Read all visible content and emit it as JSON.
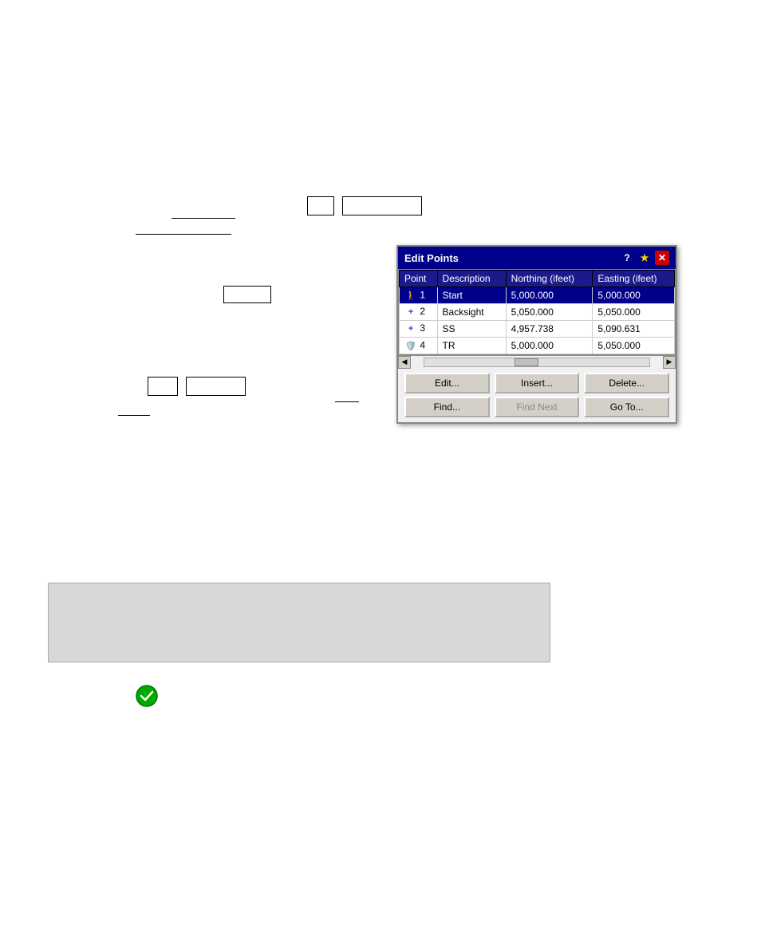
{
  "page": {
    "background": "#ffffff"
  },
  "topElements": {
    "box1": {
      "label": ""
    },
    "box2": {
      "label": ""
    },
    "underline1": {
      "text": ""
    },
    "underline2": {
      "text": ""
    },
    "smallBox": {
      "label": ""
    },
    "bottomBox1": {
      "label": ""
    },
    "bottomBox2": {
      "label": ""
    },
    "underline3": {
      "text": ""
    }
  },
  "dialog": {
    "title": "Edit Points",
    "helpIcon": "?",
    "pinIcon": "★",
    "closeIcon": "✕",
    "columns": [
      "Point",
      "Description",
      "Northing (ifeet)",
      "Easting (ifeet)"
    ],
    "rows": [
      {
        "id": 1,
        "icon": "person",
        "description": "Start",
        "northing": "5,000.000",
        "easting": "5,000.000",
        "selected": true
      },
      {
        "id": 2,
        "icon": "plus",
        "description": "Backsight",
        "northing": "5,050.000",
        "easting": "5,050.000",
        "selected": false
      },
      {
        "id": 3,
        "icon": "plus",
        "description": "SS",
        "northing": "4,957.738",
        "easting": "5,090.631",
        "selected": false
      },
      {
        "id": 4,
        "icon": "shield",
        "description": "TR",
        "northing": "5,000.000",
        "easting": "5,050.000",
        "selected": false
      }
    ],
    "buttons": {
      "row1": [
        "Edit...",
        "Insert...",
        "Delete..."
      ],
      "row2": [
        "Find...",
        "Find Next",
        "Go To..."
      ]
    },
    "findNextDisabled": true
  },
  "grayBox": {},
  "greenCheck": {
    "symbol": "✓"
  }
}
